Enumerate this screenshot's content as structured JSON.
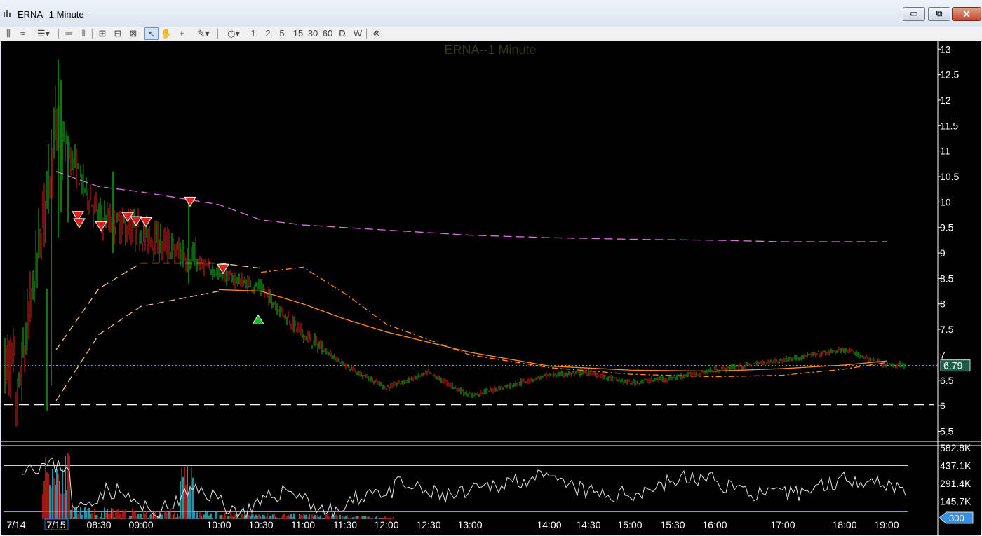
{
  "window": {
    "title": "ERNA--1 Minute--",
    "minimize_label": "▭",
    "maximize_label": "⧉",
    "close_label": "✕"
  },
  "toolbar": {
    "buttons": [
      {
        "name": "chart-type-icon",
        "label": "⫼"
      },
      {
        "name": "line-style-icon",
        "label": "≈"
      },
      {
        "name": "indicators-icon",
        "label": "☰▾"
      },
      {
        "name": "hline-icon",
        "label": "═"
      },
      {
        "name": "vline-icon",
        "label": "‖"
      },
      {
        "name": "zoom-in-icon",
        "label": "⊞"
      },
      {
        "name": "zoom-out-icon",
        "label": "⊟"
      },
      {
        "name": "zoom-fit-icon",
        "label": "⊠"
      },
      {
        "name": "pointer-icon",
        "label": "↖"
      },
      {
        "name": "hand-icon",
        "label": "✋"
      },
      {
        "name": "crosshair-icon",
        "label": "+"
      },
      {
        "name": "pencil-icon",
        "label": "✎▾"
      },
      {
        "name": "clock-icon",
        "label": "◷▾"
      },
      {
        "name": "interval-1",
        "label": "1"
      },
      {
        "name": "interval-2",
        "label": "2"
      },
      {
        "name": "interval-5",
        "label": "5"
      },
      {
        "name": "interval-15",
        "label": "15"
      },
      {
        "name": "interval-30",
        "label": "30"
      },
      {
        "name": "interval-60",
        "label": "60"
      },
      {
        "name": "interval-d",
        "label": "D"
      },
      {
        "name": "interval-w",
        "label": "W"
      },
      {
        "name": "close-chart-icon",
        "label": "⊗"
      }
    ]
  },
  "chart_data": {
    "type": "line",
    "title": "ERNA--1 Minute",
    "y_ticks": [
      "13",
      "12.5",
      "12",
      "11.5",
      "11",
      "10.5",
      "10",
      "9.5",
      "9",
      "8.5",
      "8",
      "7.5",
      "7",
      "6.5",
      "6",
      "5.5"
    ],
    "ylim": [
      5.3,
      13.1
    ],
    "x_ticks": [
      "7/14",
      "7/15",
      "08:30",
      "09:00",
      "10:00",
      "10:30",
      "11:00",
      "11:30",
      "12:00",
      "12:30",
      "13:00",
      "14:00",
      "14:30",
      "15:00",
      "15:30",
      "16:00",
      "17:00",
      "18:00",
      "19:00"
    ],
    "last_price": "6.79",
    "reference_line": 6.02,
    "price_series": {
      "name": "price",
      "x": [
        "7/14",
        "7/15",
        "08:30",
        "09:00",
        "10:00",
        "10:30",
        "11:00",
        "11:30",
        "12:00",
        "12:30",
        "13:00",
        "14:00",
        "14:30",
        "15:00",
        "15:30",
        "16:00",
        "17:00",
        "18:00",
        "19:00"
      ],
      "values": [
        5.9,
        11.5,
        9.7,
        9.4,
        8.6,
        8.3,
        7.4,
        6.8,
        6.35,
        6.65,
        6.2,
        6.6,
        6.65,
        6.45,
        6.55,
        6.7,
        6.9,
        7.1,
        6.8
      ]
    },
    "ma_series": [
      {
        "style": "pink-dashed",
        "color": "#e26fe0",
        "x": [
          "7/15",
          "08:30",
          "09:00",
          "10:00",
          "10:30",
          "11:00",
          "12:00",
          "13:00",
          "14:00",
          "15:00",
          "16:00",
          "17:00",
          "18:00",
          "19:00"
        ],
        "values": [
          10.6,
          10.3,
          10.2,
          9.95,
          9.65,
          9.55,
          9.45,
          9.35,
          9.3,
          9.27,
          9.25,
          9.22,
          9.22,
          9.22
        ]
      },
      {
        "style": "peach-dashed",
        "color": "#f0c090",
        "x": [
          "7/15",
          "08:30",
          "09:00",
          "10:00",
          "10:30"
        ],
        "values": [
          7.1,
          8.3,
          8.8,
          8.8,
          8.7
        ]
      },
      {
        "style": "orange-dashdot",
        "color": "#ff8c1a",
        "x": [
          "10:30",
          "11:00",
          "11:30",
          "12:00",
          "13:00",
          "14:00",
          "15:00",
          "16:00",
          "17:00",
          "18:00",
          "19:00"
        ],
        "values": [
          8.62,
          8.72,
          8.2,
          7.6,
          7.0,
          6.75,
          6.62,
          6.57,
          6.6,
          6.72,
          6.85
        ]
      },
      {
        "style": "peach-dashed2",
        "color": "#f0c090",
        "x": [
          "7/15",
          "08:30",
          "09:00",
          "10:00"
        ],
        "values": [
          6.1,
          7.4,
          7.95,
          8.25
        ]
      },
      {
        "style": "orange-solid",
        "color": "#ff8c1a",
        "x": [
          "10:00",
          "10:30",
          "11:00",
          "11:30",
          "12:00",
          "13:00",
          "14:00",
          "15:00",
          "16:00",
          "17:00",
          "18:00",
          "19:00"
        ],
        "values": [
          8.28,
          8.25,
          8.0,
          7.7,
          7.45,
          7.05,
          6.78,
          6.7,
          6.68,
          6.73,
          6.8,
          6.88
        ]
      }
    ],
    "sell_signals": [
      {
        "x": "08:30",
        "y": 9.72
      },
      {
        "x": "08:30",
        "y": 9.58
      },
      {
        "x": "08:30",
        "y": 9.52
      },
      {
        "x": "09:00",
        "y": 9.7
      },
      {
        "x": "09:00",
        "y": 9.62
      },
      {
        "x": "09:00",
        "y": 9.6
      },
      {
        "x": "10:00",
        "y": 10.0
      },
      {
        "x": "10:30",
        "y": 8.68
      }
    ],
    "buy_signals": [
      {
        "x": "10:30",
        "y": 7.7
      }
    ],
    "volume": {
      "y_ticks": [
        "582.8K",
        "437.1K",
        "291.4K",
        "145.7K"
      ],
      "ylim": [
        0,
        582800
      ],
      "upper_line": 437100,
      "lower_line": 60000,
      "length_label": "300"
    }
  }
}
